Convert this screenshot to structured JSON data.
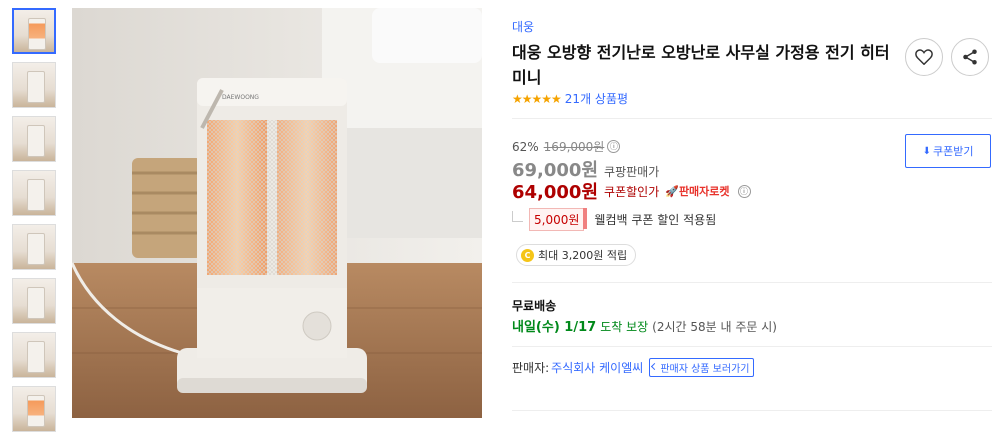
{
  "brand": "대웅",
  "title": "대웅 오방향 전기난로 오방난로 사무실 가정용 전기 히터 미니",
  "rating": {
    "stars": "★★★★★",
    "count_text": "21개 상품평",
    "value": 5
  },
  "price": {
    "discount_rate": "62%",
    "original_price": "169,000원",
    "sale_price": "69,000원",
    "sale_label": "쿠팡판매가",
    "coupon_price": "64,000원",
    "coupon_label": "쿠폰할인가",
    "rocket_badge": "판매자로켓",
    "info_icon": "ⓘ"
  },
  "cashback": {
    "amount": "5,000원",
    "text": "웰컴백 쿠폰 할인 적용됨"
  },
  "points": {
    "coin": "C",
    "text": "최대 3,200원 적립"
  },
  "coupon_button": {
    "label": "쿠폰받기",
    "icon": "download-icon"
  },
  "shipping": {
    "title": "무료배송",
    "date": "내일(수) 1/17",
    "guarantee": "도착 보장",
    "note": "(2시간 58분 내 주문 시)"
  },
  "seller": {
    "label": "판매자:",
    "name": "주식회사 케이엘씨",
    "button": "판매자 상품 보러가기"
  },
  "heater_brand_text": "DAEWOONG",
  "colors": {
    "accent": "#346aff",
    "price_red": "#ae0000",
    "shipping_green": "#00891a",
    "star": "#f5a300"
  }
}
